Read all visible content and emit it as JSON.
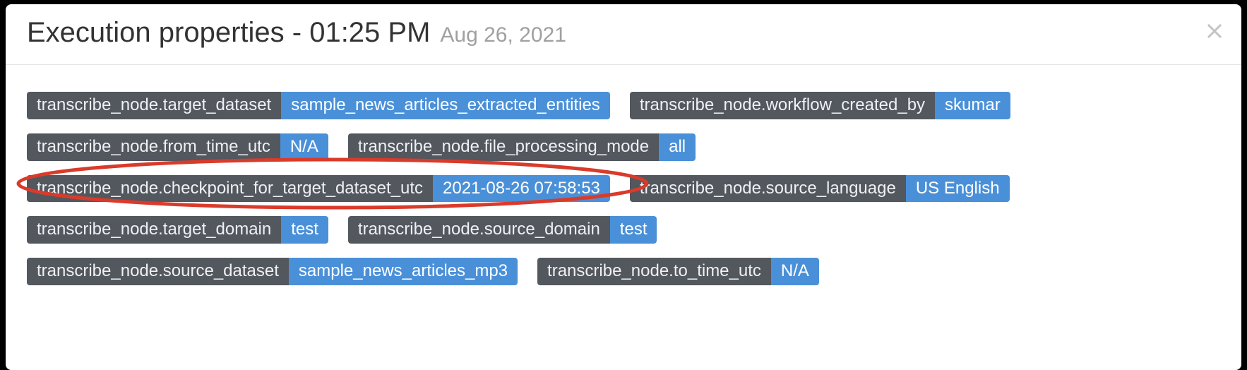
{
  "header": {
    "title_main": "Execution properties - 01:25 PM",
    "title_sub": "Aug 26, 2021"
  },
  "rows": [
    [
      {
        "key": "transcribe_node.target_dataset",
        "val": "sample_news_articles_extracted_entities"
      },
      {
        "key": "transcribe_node.workflow_created_by",
        "val": "skumar"
      }
    ],
    [
      {
        "key": "transcribe_node.from_time_utc",
        "val": "N/A"
      },
      {
        "key": "transcribe_node.file_processing_mode",
        "val": "all"
      }
    ],
    [
      {
        "key": "transcribe_node.checkpoint_for_target_dataset_utc",
        "val": "2021-08-26 07:58:53"
      },
      {
        "key": "transcribe_node.source_language",
        "val": "US English"
      }
    ],
    [
      {
        "key": "transcribe_node.target_domain",
        "val": "test"
      },
      {
        "key": "transcribe_node.source_domain",
        "val": "test"
      }
    ],
    [
      {
        "key": "transcribe_node.source_dataset",
        "val": "sample_news_articles_mp3"
      },
      {
        "key": "transcribe_node.to_time_utc",
        "val": "N/A"
      }
    ]
  ],
  "highlight": {
    "row": 2,
    "item": 0
  }
}
